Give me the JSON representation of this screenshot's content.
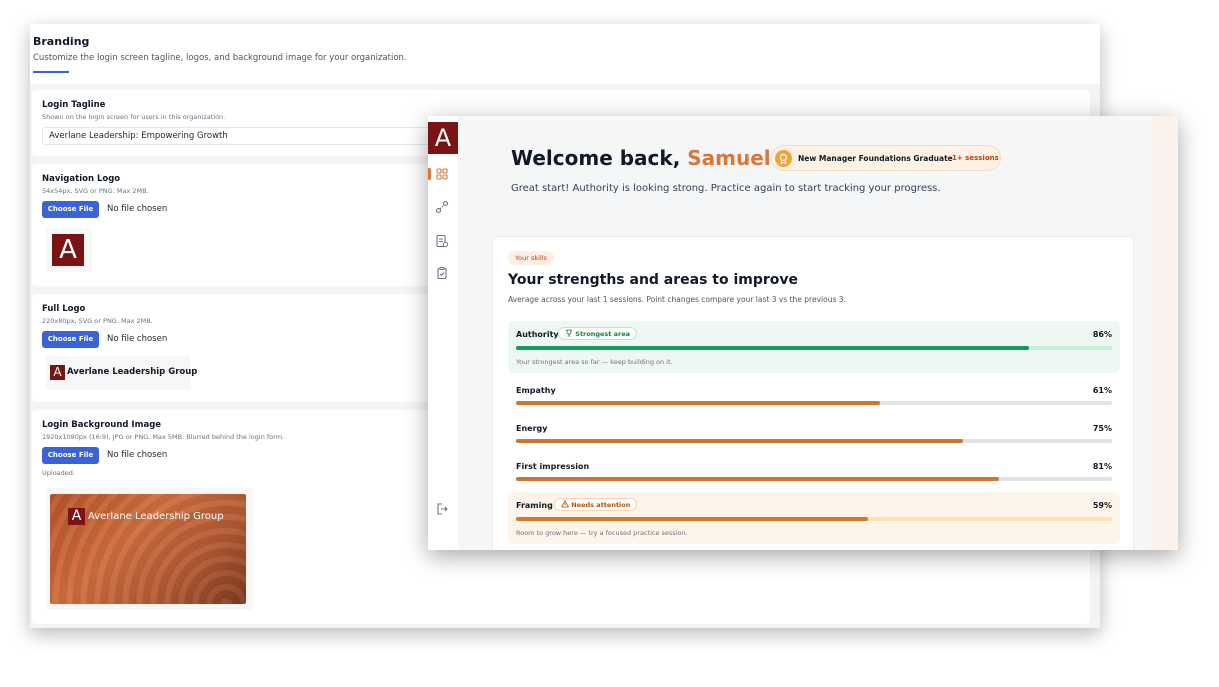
{
  "branding": {
    "title": "Branding",
    "subtitle": "Customize the login screen tagline, logos, and background image for your organization."
  },
  "login_tagline": {
    "label": "Login Tagline",
    "hint": "Shown on the login screen for users in this organization.",
    "value": "Averlane Leadership: Empowering Growth"
  },
  "navigation_logo": {
    "label": "Navigation Logo",
    "hint": "54x54px, SVG or PNG. Max 2MB.",
    "button": "Choose File",
    "file_status": "No file chosen",
    "preview_letter": "A"
  },
  "full_logo": {
    "label": "Full Logo",
    "hint": "220x80px, SVG or PNG. Max 2MB.",
    "button": "Choose File",
    "file_status": "No file chosen",
    "preview_letter": "A",
    "preview_text": "Averlane Leadership Group"
  },
  "login_background": {
    "label": "Login Background Image",
    "hint": "1920x1080px (16:9), JPG or PNG. Max 5MB. Blurred behind the login form.",
    "button": "Choose File",
    "file_status": "No file chosen",
    "status": "Uploaded.",
    "preview_letter": "A",
    "preview_text": "Averlane Leadership Group"
  },
  "dashboard": {
    "logo_letter": "A",
    "welcome_prefix": "Welcome back,",
    "user_name": "Samuel",
    "badge_text": "New Manager Foundations Graduate",
    "badge_sessions": "1+ sessions",
    "subtitle": "Great start! Authority is looking strong. Practice again to start tracking your progress.",
    "skills_badge": "Your skills",
    "skills_title": "Your strengths and areas to improve",
    "skills_subtitle": "Average across your last 1 sessions. Point changes compare your last 3 vs the previous 3.",
    "skills": [
      {
        "name": "Authority",
        "value": 86,
        "pct_label": "86%",
        "tag": "Strongest area",
        "note": "Your strongest area so far — keep building on it."
      },
      {
        "name": "Empathy",
        "value": 61,
        "pct_label": "61%"
      },
      {
        "name": "Energy",
        "value": 75,
        "pct_label": "75%"
      },
      {
        "name": "First impression",
        "value": 81,
        "pct_label": "81%"
      },
      {
        "name": "Framing",
        "value": 59,
        "pct_label": "59%",
        "tag": "Needs attention",
        "note": "Room to grow here — try a focused practice session."
      }
    ]
  },
  "colors": {
    "accent_orange": "#d97736",
    "strong_green": "#129a5c",
    "strong_track": "#c6f0d9",
    "weak_fill": "#d4762d",
    "weak_track": "#fde3b0",
    "neutral_fill": "#cf7636",
    "neutral_track": "#dfe3ea",
    "button_blue": "#3b63d8",
    "logo_red": "#7a1414"
  }
}
